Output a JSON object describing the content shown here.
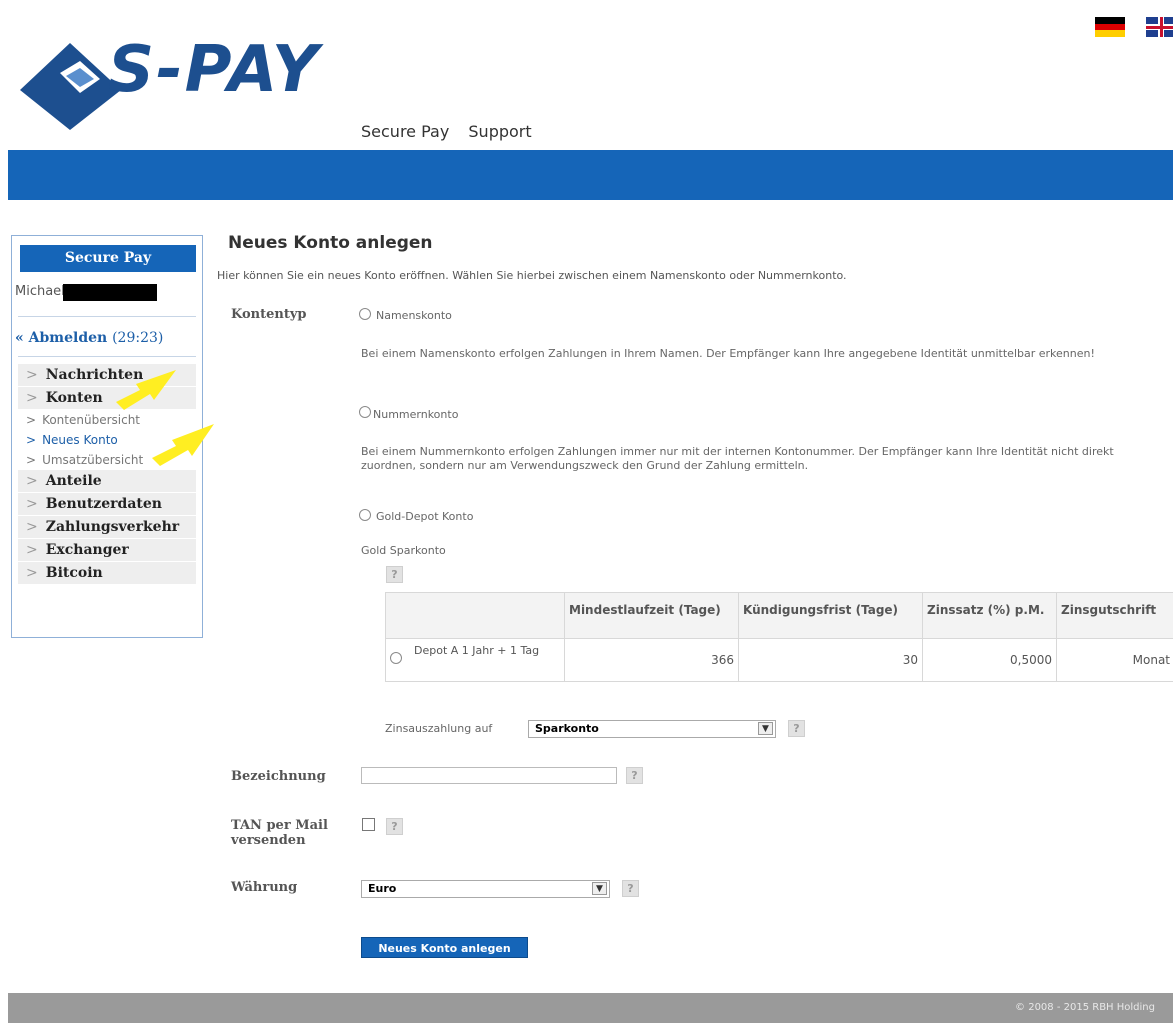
{
  "header": {
    "logo_text": "S-PAY",
    "nav": [
      "Secure Pay",
      "Support"
    ],
    "languages": [
      "de",
      "en"
    ]
  },
  "sidebar": {
    "title": "Secure Pay",
    "user": "Michael",
    "logout_label": "« Abmelden",
    "session_timer": "(29:23)",
    "menu": [
      {
        "label": "Nachrichten"
      },
      {
        "label": "Konten",
        "children": [
          "Kontenübersicht",
          "Neues Konto",
          "Umsatzübersicht"
        ]
      },
      {
        "label": "Anteile"
      },
      {
        "label": "Benutzerdaten"
      },
      {
        "label": "Zahlungsverkehr"
      },
      {
        "label": "Exchanger"
      },
      {
        "label": "Bitcoin"
      }
    ],
    "active_child": "Neues Konto"
  },
  "main": {
    "title": "Neues Konto anlegen",
    "intro": "Hier können Sie ein neues Konto eröffnen. Wählen Sie hierbei zwischen einem Namenskonto oder Nummernkonto.",
    "kontentyp_label": "Kontentyp",
    "options": {
      "namenskonto": "Namenskonto",
      "namenskonto_desc": "Bei einem Namenskonto erfolgen Zahlungen in Ihrem Namen. Der Empfänger kann Ihre angegebene Identität unmittelbar erkennen!",
      "nummernkonto": "Nummernkonto",
      "nummernkonto_desc": "Bei einem Nummernkonto erfolgen Zahlungen immer nur mit der internen Kontonummer. Der Empfänger kann Ihre Identität nicht direkt zuordnen, sondern nur am Verwendungszweck den Grund der Zahlung ermitteln.",
      "gold": "Gold-Depot Konto",
      "gold_sub": "Gold Sparkonto"
    },
    "table": {
      "headers": [
        "",
        "Mindestlaufzeit (Tage)",
        "Kündigungsfrist (Tage)",
        "Zinssatz (%) p.M.",
        "Zinsgutschrift"
      ],
      "rows": [
        {
          "name": "Depot A 1 Jahr + 1 Tag",
          "min": "366",
          "kuendigung": "30",
          "zins": "0,5000",
          "gutschrift": "Monat"
        }
      ]
    },
    "zinsauszahlung_label": "Zinsauszahlung auf",
    "zinsauszahlung_value": "Sparkonto",
    "bezeichnung_label": "Bezeichnung",
    "bezeichnung_value": "",
    "tan_label_1": "TAN per Mail",
    "tan_label_2": "versenden",
    "waehrung_label": "Währung",
    "waehrung_value": "Euro",
    "submit_label": "Neues Konto anlegen",
    "help_glyph": "?"
  },
  "footer": {
    "text": "© 2008 - 2015 RBH Holding"
  },
  "colors": {
    "brand_blue": "#1565b8",
    "logo_blue": "#1d4f8f",
    "highlight_yellow": "#ffee22"
  }
}
